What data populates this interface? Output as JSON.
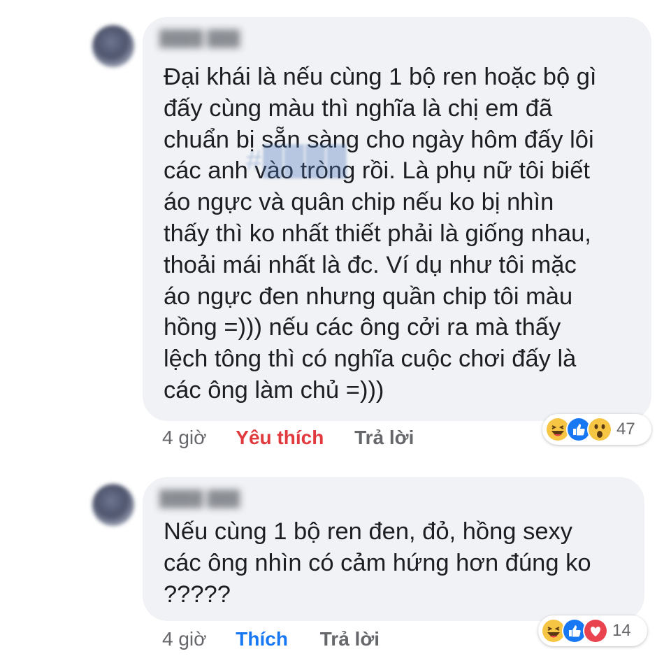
{
  "comments": [
    {
      "text": "Đại khái là nếu cùng 1 bộ ren hoặc bộ gì\nđấy cùng màu thì nghĩa là chị em đã\nchuẩn bị sẵn sàng cho ngày hôm đấy lôi\ncác anh vào tròng rồi. Là phụ nữ tôi biết\náo ngực và quân chip nếu ko bị nhìn\nthấy thì ko nhất thiết phải là giống nhau,\nthoải mái nhất là đc. Ví dụ như tôi mặc\náo ngực đen nhưng quần chip tôi màu\nhồng =))) nếu các ông cởi ra mà thấy\nlệch tông thì có nghĩa cuộc chơi đấy là\ncác ông làm chủ =)))",
      "time": "4 giờ",
      "like_label": "Yêu thích",
      "like_color": "#e0393e",
      "reply_label": "Trả lời",
      "reaction_icons": [
        "haha-icon",
        "like-icon",
        "wow-icon"
      ],
      "reaction_count": "47"
    },
    {
      "text": "Nếu cùng 1 bộ ren đen, đỏ, hồng sexy\ncác ông nhìn có cảm hứng hơn đúng ko\n?????",
      "time": "4 giờ",
      "like_label": "Thích",
      "like_color": "#1877f2",
      "reply_label": "Trả lời",
      "reaction_icons": [
        "haha-icon",
        "like-icon",
        "love-icon"
      ],
      "reaction_count": "14"
    }
  ],
  "colors": {
    "bubble": "#f0f2f5",
    "text": "#1c1e21",
    "meta": "#65676b"
  }
}
